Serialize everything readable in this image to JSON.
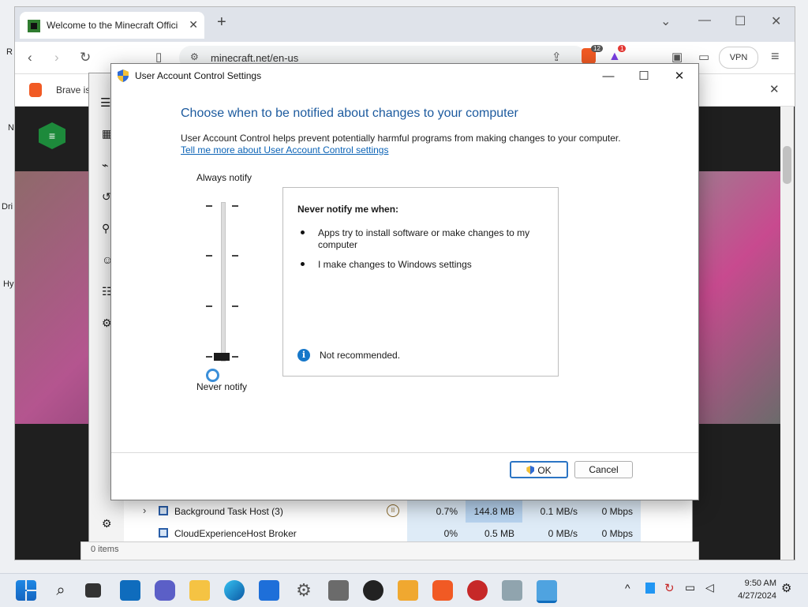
{
  "browser": {
    "tab_title": "Welcome to the Minecraft Offici",
    "url": "minecraft.net/en-us",
    "vpn_label": "VPN",
    "infobar_text": "Brave is",
    "brave_badge": "12",
    "rewards_badge": "1"
  },
  "desktop": {
    "frags": [
      "R",
      "N",
      "Dri",
      "Hy"
    ]
  },
  "taskmgr": {
    "rows": [
      {
        "name": "Background Task Host (3)",
        "cpu": "0.7%",
        "memory": "144.8 MB",
        "disk": "0.1 MB/s",
        "network": "0 Mbps",
        "expandable": true,
        "paused": true
      },
      {
        "name": "CloudExperienceHost Broker",
        "cpu": "0%",
        "memory": "0.5 MB",
        "disk": "0 MB/s",
        "network": "0 Mbps",
        "expandable": false,
        "paused": false
      }
    ],
    "status_text": "0 items"
  },
  "uac": {
    "title": "User Account Control Settings",
    "heading": "Choose when to be notified about changes to your computer",
    "description": "User Account Control helps prevent potentially harmful programs from making changes to your computer.",
    "link": "Tell me more about User Account Control settings",
    "always_label": "Always notify",
    "never_label": "Never notify",
    "slider_level": 0,
    "slider_levels_total": 4,
    "info_heading": "Never notify me when:",
    "bullets": [
      "Apps try to install software or make changes to my computer",
      "I make changes to Windows settings"
    ],
    "note": "Not recommended.",
    "ok_label": "OK",
    "cancel_label": "Cancel"
  },
  "taskbar": {
    "time": "9:50 AM",
    "date": "4/27/2024"
  },
  "colors": {
    "uac_heading": "#1c5a9e",
    "link": "#0b63b6",
    "info_icon": "#1677c9",
    "taskmgr_highlight": "#cfe3f7"
  }
}
